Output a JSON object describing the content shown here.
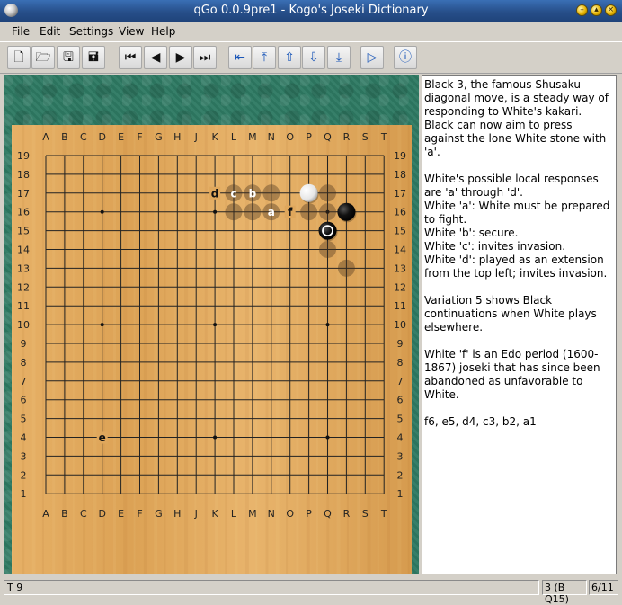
{
  "window": {
    "title": "qGo 0.0.9pre1 - Kogo's Joseki Dictionary",
    "controls": [
      "minimize",
      "maximize",
      "close"
    ]
  },
  "menu": [
    {
      "label": "File",
      "accel": "F"
    },
    {
      "label": "Edit",
      "accel": "E"
    },
    {
      "label": "Settings",
      "accel": "S"
    },
    {
      "label": "View",
      "accel": "V"
    },
    {
      "label": "Help",
      "accel": "H"
    }
  ],
  "toolbar": {
    "buttons": [
      {
        "name": "new-file-button",
        "icon": "new-file-icon",
        "glyph": "🗋"
      },
      {
        "name": "open-file-button",
        "icon": "open-folder-icon",
        "glyph": "🗁"
      },
      {
        "name": "save-button",
        "icon": "floppy-disk-icon",
        "glyph": "🖫"
      },
      {
        "name": "save-as-button",
        "icon": "floppy-disks-icon",
        "glyph": "🖬"
      },
      {
        "name": "first-move-button",
        "icon": "skip-to-start-icon",
        "glyph": "⏮"
      },
      {
        "name": "previous-move-button",
        "icon": "step-back-icon",
        "glyph": "◀"
      },
      {
        "name": "next-move-button",
        "icon": "step-forward-icon",
        "glyph": "▶"
      },
      {
        "name": "last-move-button",
        "icon": "skip-to-end-icon",
        "glyph": "⏭"
      },
      {
        "name": "prev-variation-button",
        "icon": "arrow-left-bar-icon",
        "glyph": "⇤"
      },
      {
        "name": "main-branch-button",
        "icon": "arrow-up-bar-icon",
        "glyph": "⤒"
      },
      {
        "name": "variation-up-button",
        "icon": "arrow-up-icon",
        "glyph": "⇧"
      },
      {
        "name": "variation-down-button",
        "icon": "arrow-down-icon",
        "glyph": "⇩"
      },
      {
        "name": "next-branch-button",
        "icon": "arrow-down-bar-icon",
        "glyph": "⤓"
      },
      {
        "name": "play-button",
        "icon": "play-triangle-icon",
        "glyph": "▷"
      },
      {
        "name": "info-button",
        "icon": "info-icon",
        "glyph": "ⓘ"
      }
    ]
  },
  "board": {
    "size": 19,
    "columns": [
      "A",
      "B",
      "C",
      "D",
      "E",
      "F",
      "G",
      "H",
      "J",
      "K",
      "L",
      "M",
      "N",
      "O",
      "P",
      "Q",
      "R",
      "S",
      "T"
    ],
    "rows": [
      "19",
      "18",
      "17",
      "16",
      "15",
      "14",
      "13",
      "12",
      "11",
      "10",
      "9",
      "8",
      "7",
      "6",
      "5",
      "4",
      "3",
      "2",
      "1"
    ],
    "colors": {
      "wood": "#e0a75a",
      "line": "#222222",
      "felt": "#2e7a63"
    },
    "stones": [
      {
        "point": "P17",
        "color": "white"
      },
      {
        "point": "R16",
        "color": "black"
      },
      {
        "point": "Q15",
        "color": "black",
        "last_move": true
      }
    ],
    "ghost_stones": [
      "L17",
      "M17",
      "N17",
      "Q17",
      "L16",
      "M16",
      "N16",
      "P16",
      "Q16",
      "Q14",
      "R13"
    ],
    "labels": [
      {
        "point": "K17",
        "text": "d"
      },
      {
        "point": "L17",
        "text": "c"
      },
      {
        "point": "M17",
        "text": "b"
      },
      {
        "point": "N16",
        "text": "a"
      },
      {
        "point": "O16",
        "text": "f"
      },
      {
        "point": "D4",
        "text": "e"
      }
    ],
    "hoshi": [
      "D16",
      "K16",
      "Q16",
      "D10",
      "K10",
      "Q10",
      "D4",
      "K4",
      "Q4"
    ]
  },
  "comment": {
    "paragraphs": [
      "Black 3, the famous Shusaku diagonal move, is a steady way of responding to White's kakari. Black can now aim to press against the lone White stone with 'a'.",
      "White's possible local responses are 'a' through 'd'.\nWhite 'a': White must be prepared to fight.\nWhite 'b': secure.\nWhite 'c': invites invasion.\nWhite 'd': played as an extension from the top left; invites invasion.",
      "Variation 5 shows Black continuations when White plays elsewhere.",
      "White 'f' is an Edo period (1600-1867) joseki that has since been abandoned as unfavorable to White.",
      "f6, e5, d4, c3, b2, a1"
    ]
  },
  "status": {
    "left": "T 9",
    "move": "3 (B Q15)",
    "variation": "6/11"
  }
}
